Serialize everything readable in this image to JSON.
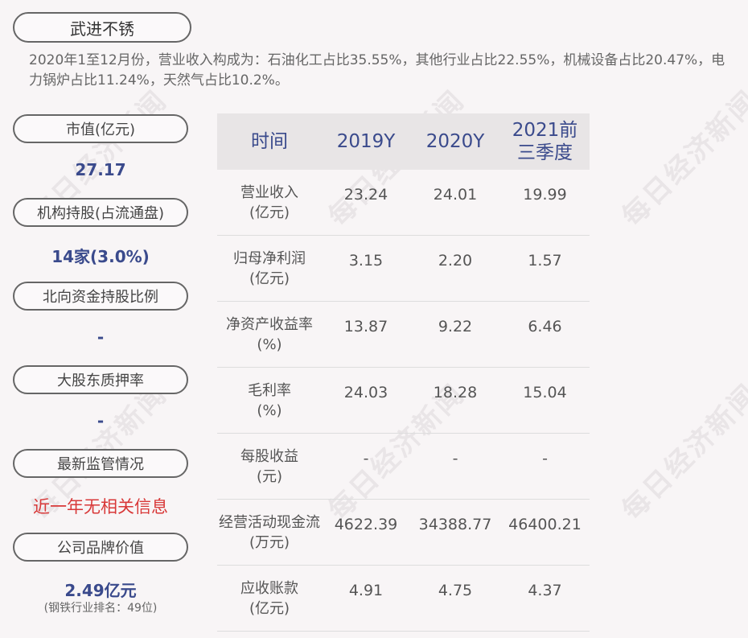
{
  "company": "武进不锈",
  "summary": "2020年1至12月份，营业收入构成为：石油化工占比35.55%，其他行业占比22.55%，机械设备占比20.47%，电力锅炉占比11.24%，天然气占比10.2%。",
  "sidebar": [
    {
      "label": "市值(亿元)",
      "value": "27.17"
    },
    {
      "label": "机构持股(占流通盘)",
      "value": "14家(3.0%)"
    },
    {
      "label": "北向资金持股比例",
      "value": "-"
    },
    {
      "label": "大股东质押率",
      "value": "-"
    },
    {
      "label": "最新监管情况",
      "value": "近一年无相关信息"
    },
    {
      "label": "公司品牌价值",
      "value": "2.49亿元",
      "sub": "(钢铁行业排名：49位)"
    }
  ],
  "table": {
    "headers": [
      "时间",
      "2019Y",
      "2020Y",
      "2021前三季度"
    ],
    "rows": [
      {
        "label": "营业收入\n(亿元)",
        "values": [
          "23.24",
          "24.01",
          "19.99"
        ]
      },
      {
        "label": "归母净利润\n(亿元)",
        "values": [
          "3.15",
          "2.20",
          "1.57"
        ]
      },
      {
        "label": "净资产收益率\n(%)",
        "values": [
          "13.87",
          "9.22",
          "6.46"
        ]
      },
      {
        "label": "毛利率\n(%)",
        "values": [
          "24.03",
          "18.28",
          "15.04"
        ]
      },
      {
        "label": "每股收益\n(元)",
        "values": [
          "-",
          "-",
          "-"
        ]
      },
      {
        "label": "经营活动现金流\n(万元)",
        "values": [
          "4622.39",
          "34388.77",
          "46400.21"
        ]
      },
      {
        "label": "应收账款\n(亿元)",
        "values": [
          "4.91",
          "4.75",
          "4.37"
        ]
      }
    ]
  },
  "watermark": "每日经济新闻"
}
